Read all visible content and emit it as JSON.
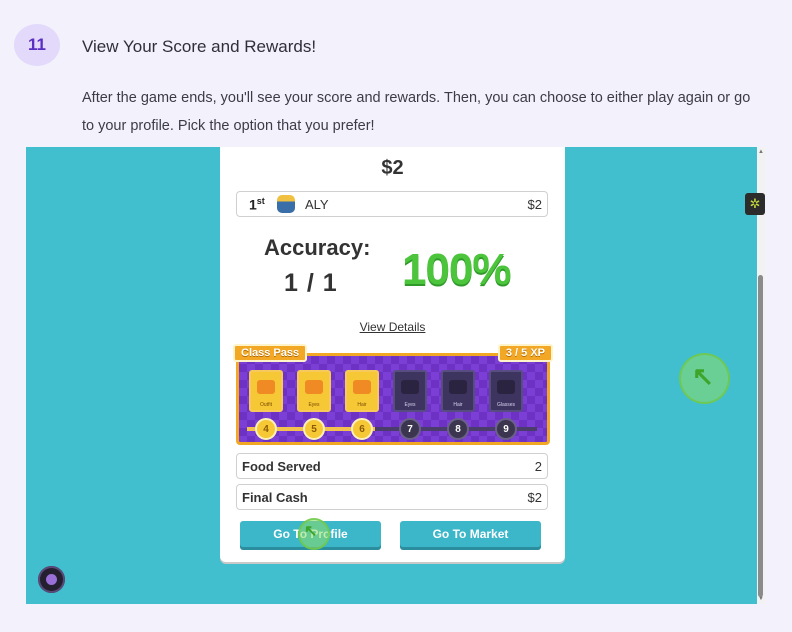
{
  "step": {
    "number": "11",
    "title": "View Your Score and Rewards!",
    "description": "After the game ends, you'll see your score and rewards. Then, you can choose to either play again or go to your profile. Pick the option that you prefer!"
  },
  "game": {
    "cash_header": "$2",
    "leaderboard": {
      "place": "1",
      "place_suffix": "st",
      "name": "ALY",
      "amount": "$2"
    },
    "accuracy": {
      "label": "Accuracy:",
      "value": "1 / 1",
      "percent": "100%"
    },
    "view_details": "View Details",
    "class_pass": {
      "label": "Class Pass",
      "xp": "3 / 5 XP",
      "rewards": [
        {
          "name": "Outfit",
          "level": "4",
          "unlocked": true
        },
        {
          "name": "Eyes",
          "level": "5",
          "unlocked": true
        },
        {
          "name": "Hair",
          "level": "6",
          "unlocked": true
        },
        {
          "name": "Eyes",
          "level": "7",
          "unlocked": false
        },
        {
          "name": "Hair",
          "level": "8",
          "unlocked": false
        },
        {
          "name": "Glasses",
          "level": "9",
          "unlocked": false
        }
      ]
    },
    "stats": [
      {
        "label": "Food Served",
        "value": "2"
      },
      {
        "label": "Final Cash",
        "value": "$2"
      }
    ],
    "buttons": {
      "profile": "Go To Profile",
      "market": "Go To Market"
    }
  },
  "colors": {
    "accent": "#5a2fc2",
    "game_bg": "#41bfcf",
    "accuracy": "#4cc53c",
    "pass": "#7b3fd6",
    "pass_gold": "#f2a824"
  }
}
